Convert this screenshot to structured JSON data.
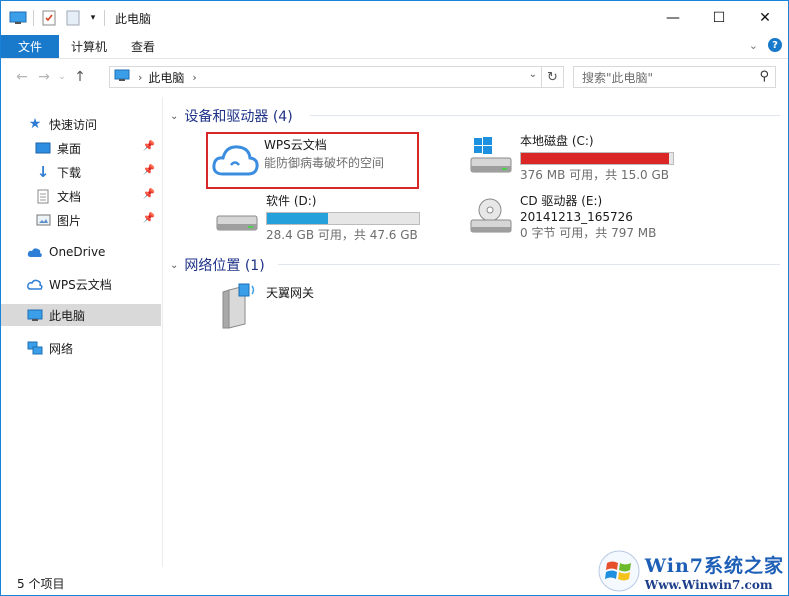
{
  "window": {
    "title": "此电脑",
    "controls": {
      "minimize": "—",
      "maximize": "☐",
      "close": "✕"
    }
  },
  "ribbon": {
    "tabs": [
      {
        "label": "文件",
        "active": true
      },
      {
        "label": "计算机"
      },
      {
        "label": "查看"
      }
    ],
    "help": "?"
  },
  "address": {
    "crumb": "此电脑",
    "search_placeholder": "搜索\"此电脑\""
  },
  "sidebar": {
    "quick_access": "快速访问",
    "items": [
      {
        "label": "桌面",
        "pinned": true
      },
      {
        "label": "下载",
        "pinned": true
      },
      {
        "label": "文档",
        "pinned": true
      },
      {
        "label": "图片",
        "pinned": true
      }
    ],
    "onedrive": "OneDrive",
    "wps": "WPS云文档",
    "this_pc": "此电脑",
    "network": "网络"
  },
  "content": {
    "devices_header": "设备和驱动器 (4)",
    "network_header": "网络位置 (1)",
    "wps_cloud": {
      "name": "WPS云文档",
      "desc": "能防御病毒破坏的空间"
    },
    "drive_c": {
      "name": "本地磁盘 (C:)",
      "space": "376 MB 可用，共 15.0 GB",
      "used_fraction": 0.976,
      "bar_color": "#da2626"
    },
    "drive_d": {
      "name": "软件 (D:)",
      "space": "28.4 GB 可用，共 47.6 GB",
      "used_fraction": 0.403,
      "bar_color": "#26a0da"
    },
    "drive_e": {
      "name": "CD 驱动器 (E:)",
      "label": "20141213_165726",
      "space": "0 字节 可用，共 797 MB"
    },
    "network_item": {
      "name": "天翼网关"
    }
  },
  "status": {
    "count": "5 个项目"
  },
  "watermark": {
    "big": "Win7系统之家",
    "small": "Www.Winwin7.com"
  }
}
